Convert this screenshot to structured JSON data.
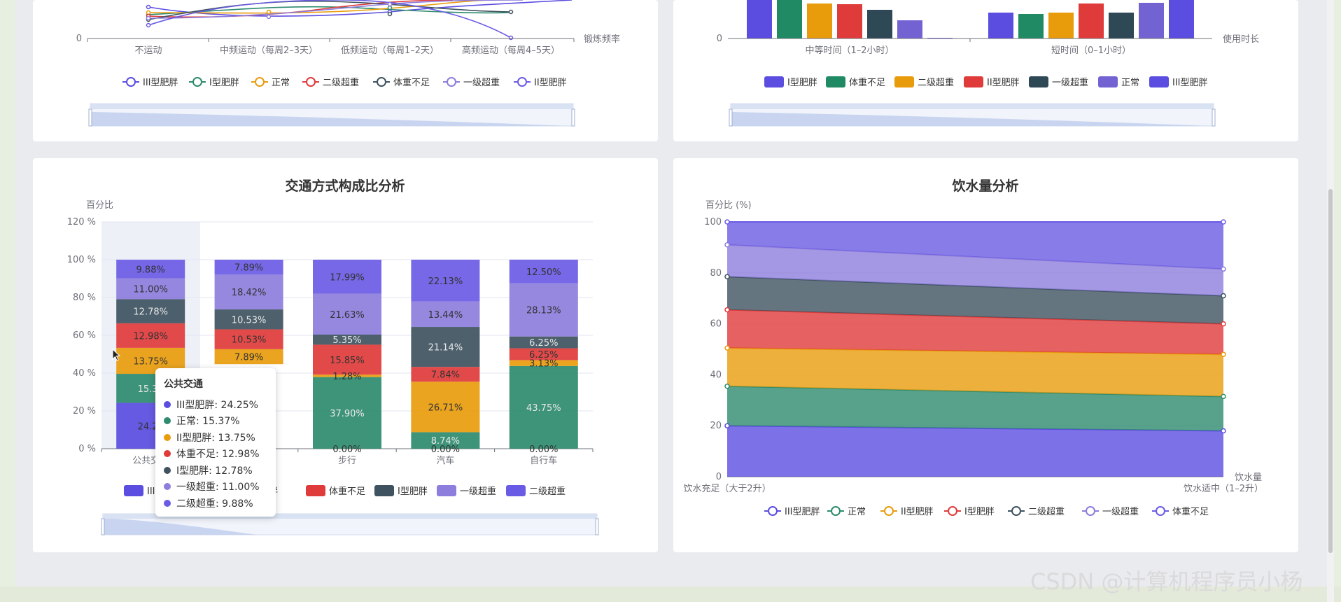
{
  "watermark": "CSDN @计算机程序员小杨",
  "charts": {
    "exercise": {
      "tick_zero": "0",
      "categories": [
        "不运动",
        "中频运动（每周2–3天）",
        "低频运动（每周1–2天）",
        "高频运动（每周4–5天）"
      ],
      "axis_name": "锻炼频率",
      "legend": [
        "III型肥胖",
        "I型肥胖",
        "正常",
        "二级超重",
        "体重不足",
        "一级超重",
        "II型肥胖"
      ]
    },
    "usage": {
      "tick_zero": "0",
      "categories": [
        "中等时间（1–2小时）",
        "短时间（0–1小时）"
      ],
      "axis_name": "使用时长",
      "legend": [
        "I型肥胖",
        "体重不足",
        "二级超重",
        "II型肥胖",
        "一级超重",
        "正常",
        "III型肥胖"
      ]
    }
  },
  "chart_data": [
    {
      "type": "bar",
      "stacked": true,
      "title": "交通方式构成比分析",
      "ylabel": "百分比",
      "y_ticks": [
        "0 %",
        "20 %",
        "40 %",
        "60 %",
        "80 %",
        "100 %",
        "120 %"
      ],
      "ylim": [
        0,
        120
      ],
      "categories": [
        "公共交通",
        "",
        "步行",
        "汽车",
        "自行车"
      ],
      "legend_visible": [
        "III",
        "体重不足",
        "I型肥胖",
        "一级超重",
        "二级超重"
      ],
      "series": [
        {
          "name": "III型肥胖",
          "color": "#5b4de0",
          "values": [
            24.25,
            null,
            0.0,
            0.0,
            0.0
          ],
          "labels": [
            "24.25",
            "",
            "0.00%",
            "0.00%",
            "0.00%"
          ]
        },
        {
          "name": "正常",
          "color": "#2e8b6e",
          "values": [
            15.37,
            null,
            37.9,
            8.74,
            43.75
          ],
          "labels": [
            "15.37",
            "",
            "37.90%",
            "8.74%",
            "43.75%"
          ]
        },
        {
          "name": "II型肥胖",
          "color": "#e89c0c",
          "values": [
            13.75,
            7.89,
            1.28,
            26.71,
            3.13
          ],
          "labels": [
            "13.75%",
            "7.89%",
            "1.28%",
            "26.71%",
            "3.13%"
          ]
        },
        {
          "name": "体重不足",
          "color": "#e03b3b",
          "values": [
            12.98,
            10.53,
            15.85,
            7.84,
            6.25
          ],
          "labels": [
            "12.98%",
            "10.53%",
            "15.85%",
            "7.84%",
            "6.25%"
          ]
        },
        {
          "name": "I型肥胖",
          "color": "#3e5260",
          "values": [
            12.78,
            10.53,
            5.35,
            21.14,
            6.25
          ],
          "labels": [
            "12.78%",
            "10.53%",
            "5.35%",
            "21.14%",
            "6.25%"
          ]
        },
        {
          "name": "一级超重",
          "color": "#8d7ddc",
          "values": [
            11.0,
            18.42,
            21.63,
            13.44,
            28.13
          ],
          "labels": [
            "11.00%",
            "18.42%",
            "21.63%",
            "13.44%",
            "28.13%"
          ]
        },
        {
          "name": "二级超重",
          "color": "#6a5be4",
          "values": [
            9.88,
            7.89,
            17.99,
            22.13,
            12.5
          ],
          "labels": [
            "9.88%",
            "7.89%",
            "17.99%",
            "22.13%",
            "12.50%"
          ]
        }
      ],
      "tooltip": {
        "title": "公共交通",
        "rows": [
          {
            "label": "III型肥胖: 24.25%",
            "color": "#5b4de0"
          },
          {
            "label": "正常: 15.37%",
            "color": "#2e8b6e"
          },
          {
            "label": "II型肥胖: 13.75%",
            "color": "#e89c0c"
          },
          {
            "label": "体重不足: 12.98%",
            "color": "#e03b3b"
          },
          {
            "label": "I型肥胖: 12.78%",
            "color": "#3e5260"
          },
          {
            "label": "一级超重: 11.00%",
            "color": "#8d7ddc"
          },
          {
            "label": "二级超重: 9.88%",
            "color": "#6a5be4"
          }
        ]
      }
    },
    {
      "type": "area",
      "stacked": true,
      "title": "饮水量分析",
      "ylabel": "百分比 (%)",
      "xlabel": "饮水量",
      "x": [
        "饮水充足（大于2升）",
        "饮水适中（1–2升）"
      ],
      "y_ticks": [
        "0",
        "20",
        "40",
        "60",
        "80",
        "100"
      ],
      "ylim": [
        0,
        100
      ],
      "series": [
        {
          "name": "III型肥胖",
          "color": "#5b4de0",
          "values": [
            20.0,
            18.0
          ]
        },
        {
          "name": "正常",
          "color": "#2e8b6e",
          "values": [
            15.5,
            13.5
          ]
        },
        {
          "name": "II型肥胖",
          "color": "#e89c0c",
          "values": [
            15.0,
            16.5
          ]
        },
        {
          "name": "I型肥胖",
          "color": "#e03b3b",
          "values": [
            15.0,
            12.0
          ]
        },
        {
          "name": "二级超重",
          "color": "#3e5260",
          "values": [
            13.0,
            11.0
          ]
        },
        {
          "name": "一级超重",
          "color": "#8d7ddc",
          "values": [
            12.5,
            10.5
          ]
        },
        {
          "name": "体重不足",
          "color": "#6a5be4",
          "values": [
            9.0,
            18.5
          ]
        }
      ]
    }
  ]
}
